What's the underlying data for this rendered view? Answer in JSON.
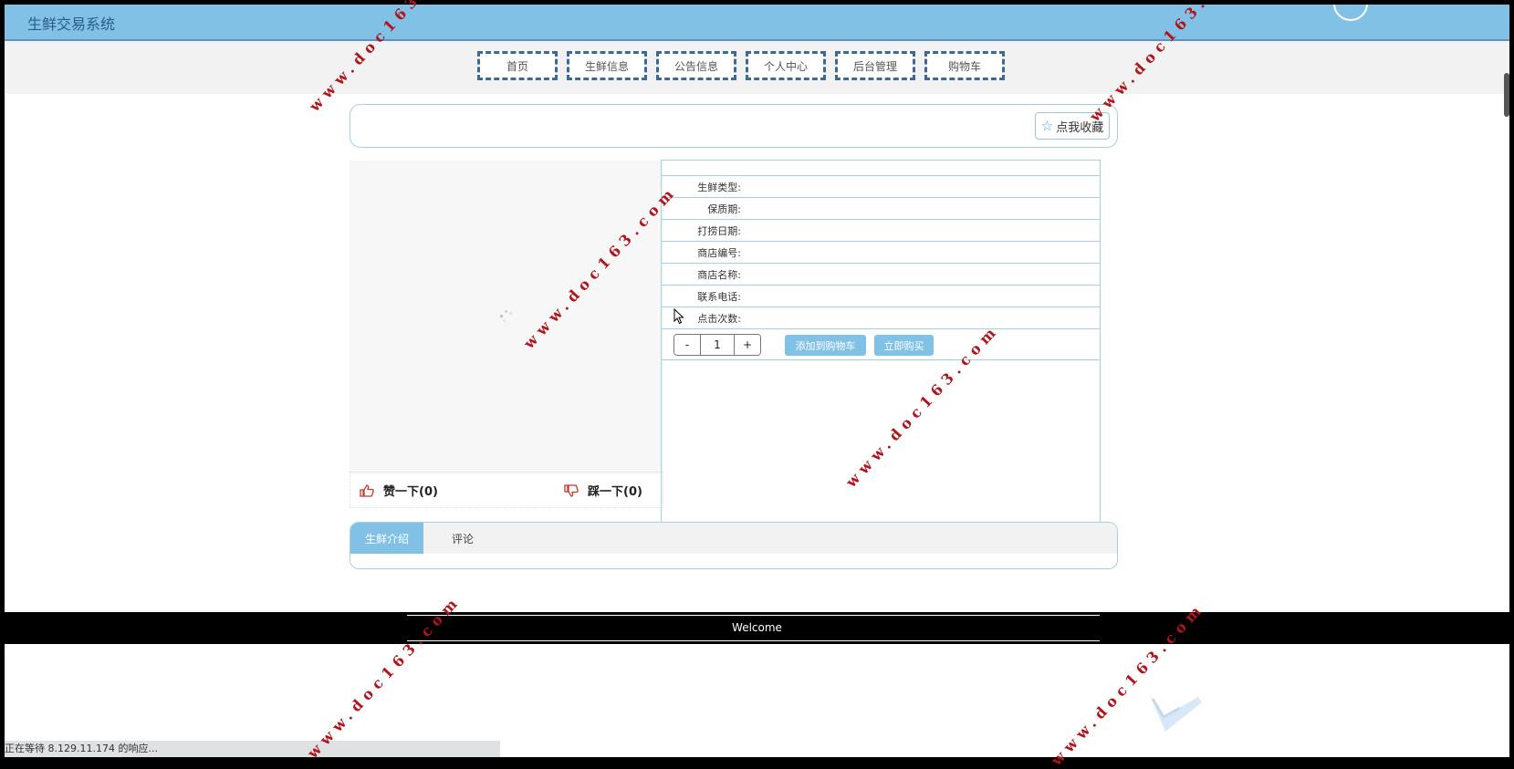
{
  "header": {
    "title": "生鲜交易系统"
  },
  "nav": {
    "items": [
      "首页",
      "生鲜信息",
      "公告信息",
      "个人中心",
      "后台管理",
      "购物车"
    ]
  },
  "favorite": {
    "label": "点我收藏"
  },
  "details": {
    "fields": [
      "生鲜类型:",
      "保质期:",
      "打捞日期:",
      "商店编号:",
      "商店名称:",
      "联系电话:",
      "点击次数:"
    ],
    "quantity": {
      "minus": "-",
      "value": "1",
      "plus": "+"
    },
    "add_to_cart": "添加到购物车",
    "buy_now": "立即购买"
  },
  "votes": {
    "like": "赞一下(0)",
    "dislike": "踩一下(0)"
  },
  "tabs": [
    "生鲜介绍",
    "评论"
  ],
  "footer": {
    "welcome": "Welcome"
  },
  "statusbar": {
    "text": "正在等待 8.129.11.174 的响应..."
  },
  "watermark": {
    "text": "www.doc163.com"
  },
  "colors": {
    "header_bg": "#82c1e6",
    "accent": "#82c1e6",
    "watermark": "#b0151c"
  }
}
